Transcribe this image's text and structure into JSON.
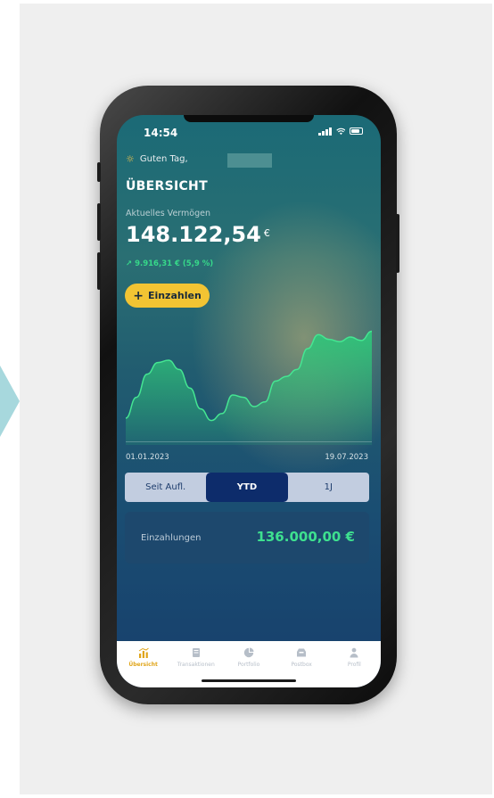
{
  "status": {
    "time": "14:54"
  },
  "header": {
    "greeting": "Guten Tag,",
    "title": "ÜBERSICHT",
    "subtitle": "Aktuelles Vermögen",
    "amount": "148.122,54",
    "currency": "€",
    "change": "↗ 9.916,31 € (5,9 %)",
    "deposit_label": "Einzahlen"
  },
  "chart_data": {
    "type": "area",
    "x_start_label": "01.01.2023",
    "x_end_label": "19.07.2023",
    "values": [
      0.2,
      0.38,
      0.58,
      0.68,
      0.7,
      0.62,
      0.46,
      0.28,
      0.18,
      0.24,
      0.4,
      0.38,
      0.3,
      0.34,
      0.52,
      0.56,
      0.62,
      0.8,
      0.92,
      0.88,
      0.86,
      0.9,
      0.87,
      0.95
    ],
    "fill_color": "#2fc57a",
    "line_color": "#45e692"
  },
  "range_selector": {
    "options": [
      "Seit Aufl.",
      "YTD",
      "1J"
    ],
    "selected": "YTD"
  },
  "deposits_card": {
    "label": "Einzahlungen",
    "value": "136.000,00 €"
  },
  "tabbar": {
    "items": [
      {
        "label": "Übersicht",
        "icon": "bar-chart-icon",
        "active": true
      },
      {
        "label": "Transaktionen",
        "icon": "receipt-icon",
        "active": false
      },
      {
        "label": "Portfolio",
        "icon": "pie-chart-icon",
        "active": false
      },
      {
        "label": "Postbox",
        "icon": "inbox-icon",
        "active": false
      },
      {
        "label": "Profil",
        "icon": "person-icon",
        "active": false
      }
    ]
  },
  "colors": {
    "accent_yellow": "#f2c433",
    "positive_green": "#37d98a",
    "navy": "#0d2c6b"
  }
}
